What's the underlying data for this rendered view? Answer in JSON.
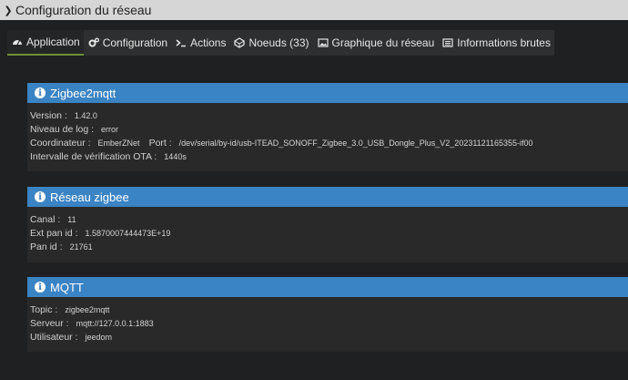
{
  "window": {
    "title": "Configuration du réseau"
  },
  "tabs": [
    {
      "label": "Application",
      "icon": "dashboard-icon",
      "active": true
    },
    {
      "label": "Configuration",
      "icon": "cogs-icon"
    },
    {
      "label": "Actions",
      "icon": "terminal-icon"
    },
    {
      "label": "Noeuds (33)",
      "icon": "nodes-icon"
    },
    {
      "label": "Graphique du réseau",
      "icon": "image-icon"
    },
    {
      "label": "Informations brutes",
      "icon": "list-icon"
    }
  ],
  "panels": {
    "zigbee2mqtt": {
      "title": "Zigbee2mqtt",
      "version_label": "Version :",
      "version": "1.42.0",
      "log_label": "Niveau de log :",
      "log": "error",
      "coord_label": "Coordinateur :",
      "coord": "EmberZNet",
      "port_label": "Port :",
      "port": "/dev/serial/by-id/usb-ITEAD_SONOFF_Zigbee_3.0_USB_Dongle_Plus_V2_20231121165355-if00",
      "ota_label": "Intervalle de vérification OTA :",
      "ota": "1440s"
    },
    "zigbee": {
      "title": "Réseau zigbee",
      "canal_label": "Canal :",
      "canal": "11",
      "ext_label": "Ext pan id :",
      "ext": "1.5870007444473E+19",
      "pan_label": "Pan id :",
      "pan": "21761"
    },
    "mqtt": {
      "title": "MQTT",
      "topic_label": "Topic :",
      "topic": "zigbee2mqtt",
      "server_label": "Serveur :",
      "server": "mqtt://127.0.0.1:1883",
      "user_label": "Utilisateur :",
      "user": "jeedom"
    }
  },
  "colors": {
    "panel_header": "#3a83c4",
    "active_tab_underline": "#6d8f3a",
    "background": "#1f2021"
  }
}
